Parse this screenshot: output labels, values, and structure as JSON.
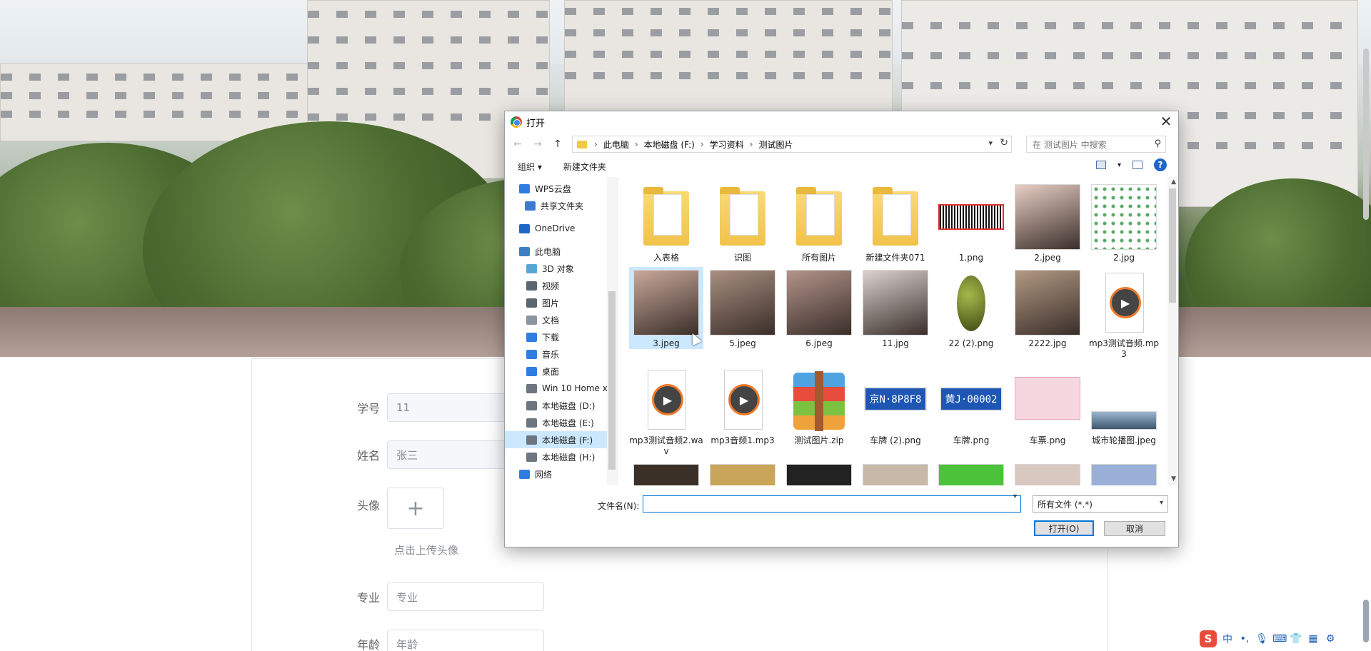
{
  "page": {
    "form": {
      "student_id_label": "学号",
      "student_id_value": "11",
      "name_label": "姓名",
      "name_value": "张三",
      "avatar_label": "头像",
      "avatar_plus": "+",
      "avatar_hint": "点击上传头像",
      "major_label": "专业",
      "major_placeholder": "专业",
      "age_label": "年龄",
      "age_placeholder": "年龄"
    },
    "ime": {
      "logo": "S",
      "mode": "中"
    }
  },
  "dialog": {
    "title": "打开",
    "close": "✕",
    "nav": {
      "back": "←",
      "forward": "→",
      "up": "↑"
    },
    "breadcrumb": [
      "此电脑",
      "本地磁盘 (F:)",
      "学习资料",
      "测试图片"
    ],
    "search_placeholder": "在 测试图片 中搜索",
    "toolbar": {
      "organize": "组织 ▾",
      "new_folder": "新建文件夹",
      "help": "?"
    },
    "sidebar": [
      {
        "label": "WPS云盘",
        "icon": "cloud-icon",
        "color": "#2f7de1"
      },
      {
        "label": "共享文件夹",
        "icon": "share-icon",
        "color": "#3a7bd5"
      },
      {
        "label": "OneDrive",
        "icon": "onedrive-icon",
        "color": "#1e66c8"
      },
      {
        "label": "此电脑",
        "icon": "computer-icon",
        "color": "#3d7fc4"
      },
      {
        "label": "3D 对象",
        "icon": "3d-objects-icon",
        "color": "#58a6d6"
      },
      {
        "label": "视频",
        "icon": "video-icon",
        "color": "#59656f"
      },
      {
        "label": "图片",
        "icon": "pictures-icon",
        "color": "#59656f"
      },
      {
        "label": "文档",
        "icon": "documents-icon",
        "color": "#8a95a0"
      },
      {
        "label": "下载",
        "icon": "download-icon",
        "color": "#2f7de1"
      },
      {
        "label": "音乐",
        "icon": "music-icon",
        "color": "#2f7de1"
      },
      {
        "label": "桌面",
        "icon": "desktop-icon",
        "color": "#2f7de1"
      },
      {
        "label": "Win 10 Home x",
        "icon": "drive-icon",
        "color": "#6b7680"
      },
      {
        "label": "本地磁盘 (D:)",
        "icon": "drive-icon",
        "color": "#6b7680"
      },
      {
        "label": "本地磁盘 (E:)",
        "icon": "drive-icon",
        "color": "#6b7680"
      },
      {
        "label": "本地磁盘 (F:)",
        "icon": "drive-icon",
        "color": "#6b7680"
      },
      {
        "label": "本地磁盘 (H:)",
        "icon": "drive-icon",
        "color": "#6b7680"
      },
      {
        "label": "网络",
        "icon": "network-icon",
        "color": "#2f7de1"
      }
    ],
    "files": [
      {
        "name": "入表格",
        "kind": "folder"
      },
      {
        "name": "识图",
        "kind": "folder"
      },
      {
        "name": "所有图片",
        "kind": "folder"
      },
      {
        "name": "新建文件夹071",
        "kind": "folder"
      },
      {
        "name": "1.png",
        "kind": "barcode"
      },
      {
        "name": "2.jpeg",
        "kind": "photo",
        "color": "#e8cfc4"
      },
      {
        "name": "2.jpg",
        "kind": "graph"
      },
      {
        "name": "3.jpeg",
        "kind": "photo",
        "color": "#c9a89a"
      },
      {
        "name": "5.jpeg",
        "kind": "photo",
        "color": "#a88f80"
      },
      {
        "name": "6.jpeg",
        "kind": "photo",
        "color": "#b3948a"
      },
      {
        "name": "11.jpg",
        "kind": "photo",
        "color": "#d9d3cf"
      },
      {
        "name": "22 (2).png",
        "kind": "beetle"
      },
      {
        "name": "2222.jpg",
        "kind": "photo",
        "color": "#b29a83"
      },
      {
        "name": "mp3测试音频.mp3",
        "kind": "audio"
      },
      {
        "name": "mp3测试音频2.wav",
        "kind": "audio"
      },
      {
        "name": "mp3音频1.mp3",
        "kind": "audio"
      },
      {
        "name": "测试图片.zip",
        "kind": "zip"
      },
      {
        "name": "车牌 (2).png",
        "kind": "plate",
        "plate": "京N·8P8F8"
      },
      {
        "name": "车牌.png",
        "kind": "plate",
        "plate": "黄J·00002"
      },
      {
        "name": "车票.png",
        "kind": "ticket"
      },
      {
        "name": "城市轮播图.jpeg",
        "kind": "city"
      }
    ],
    "filename_label": "文件名(N):",
    "filename_value": "",
    "filetype": "所有文件 (*.*)",
    "open_button": "打开(O)",
    "cancel_button": "取消"
  }
}
